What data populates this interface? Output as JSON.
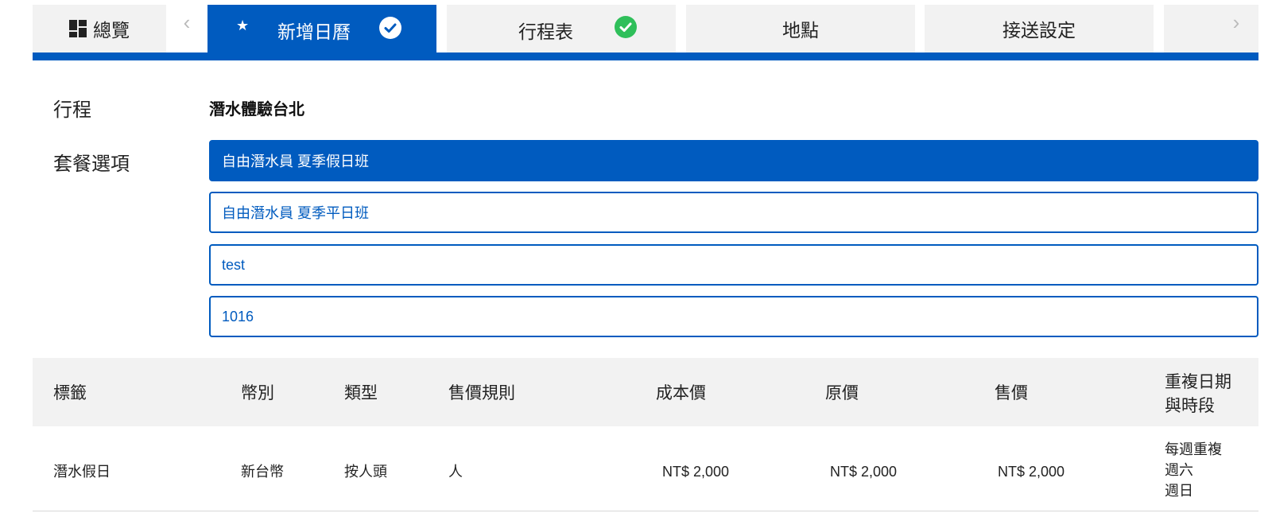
{
  "tabs": {
    "overview": "總覽",
    "calendar": "新增日曆",
    "schedule": "行程表",
    "place": "地點",
    "transfer": "接送設定"
  },
  "nav": {
    "prev": "‹",
    "next": "›"
  },
  "form": {
    "trip_label": "行程",
    "trip_value": "潛水體驗台北",
    "plan_label": "套餐選項",
    "options": [
      {
        "label": "自由潛水員 夏季假日班",
        "selected": true
      },
      {
        "label": "自由潛水員 夏季平日班",
        "selected": false
      },
      {
        "label": "test",
        "selected": false
      },
      {
        "label": "1016",
        "selected": false
      }
    ]
  },
  "table": {
    "headers": {
      "tag": "標籤",
      "currency": "幣別",
      "type": "類型",
      "rule": "售價規則",
      "cost": "成本價",
      "orig": "原價",
      "price": "售價",
      "repeat_line1": "重複日期",
      "repeat_line2": "與時段"
    },
    "rows": [
      {
        "tag": "潛水假日",
        "currency": "新台幣",
        "type": "按人頭",
        "rule": "人",
        "cost": "NT$ 2,000",
        "orig": "NT$ 2,000",
        "price": "NT$ 2,000",
        "repeat": [
          "每週重複",
          "週六",
          "週日"
        ]
      }
    ]
  },
  "colors": {
    "accent": "#005bbf",
    "tab_bg": "#f2f2f2",
    "success": "#2fbf5a"
  }
}
